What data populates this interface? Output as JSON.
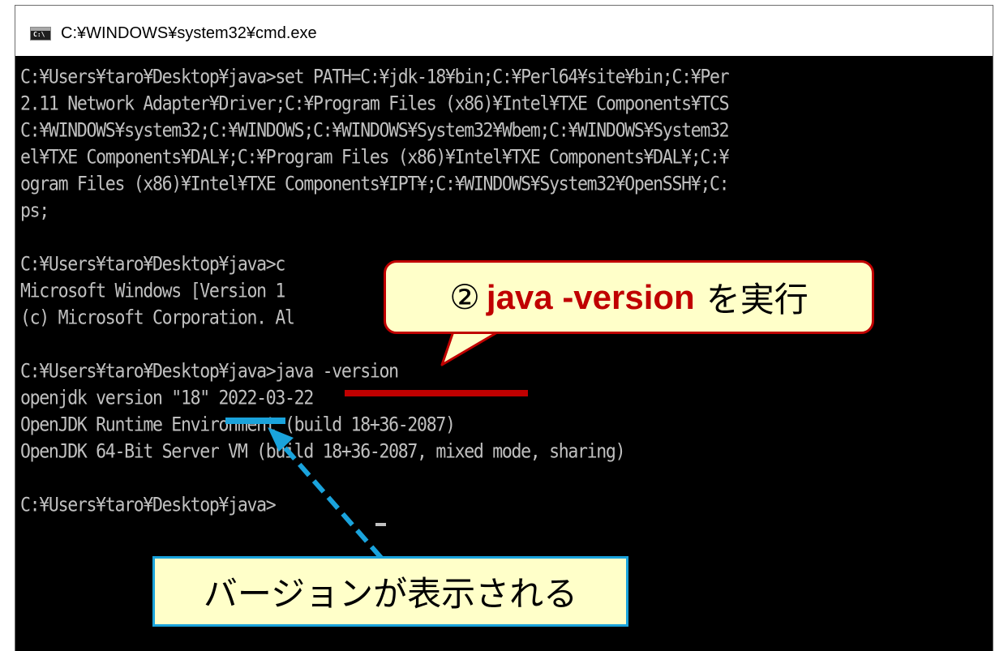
{
  "window": {
    "title": "C:¥WINDOWS¥system32¥cmd.exe",
    "icon": "cmd-window-icon",
    "icon_glyph": "C:\\"
  },
  "console": {
    "lines": [
      "C:¥Users¥taro¥Desktop¥java>set PATH=C:¥jdk-18¥bin;C:¥Perl64¥site¥bin;C:¥Per",
      "2.11 Network Adapter¥Driver;C:¥Program Files (x86)¥Intel¥TXE Components¥TCS",
      "C:¥WINDOWS¥system32;C:¥WINDOWS;C:¥WINDOWS¥System32¥Wbem;C:¥WINDOWS¥System32",
      "el¥TXE Components¥DAL¥;C:¥Program Files (x86)¥Intel¥TXE Components¥DAL¥;C:¥",
      "ogram Files (x86)¥Intel¥TXE Components¥IPT¥;C:¥WINDOWS¥System32¥OpenSSH¥;C:",
      "ps;",
      "",
      "C:¥Users¥taro¥Desktop¥java>c",
      "Microsoft Windows [Version 1",
      "(c) Microsoft Corporation. Al",
      "",
      "C:¥Users¥taro¥Desktop¥java>java -version",
      "openjdk version \"18\" 2022-03-22",
      "OpenJDK Runtime Environment (build 18+36-2087)",
      "OpenJDK 64-Bit Server VM (build 18+36-2087, mixed mode, sharing)",
      "",
      "C:¥Users¥taro¥Desktop¥java>"
    ],
    "text_color": "#c0c0c0",
    "background": "#000000"
  },
  "annotations": {
    "callout_prefix": "②",
    "callout_command": "java -version",
    "callout_suffix": "を実行",
    "callout_border_color": "#c00000",
    "label": "バージョンが表示される",
    "label_border_color": "#1aa3dc",
    "fill_color": "#ffffc9"
  }
}
